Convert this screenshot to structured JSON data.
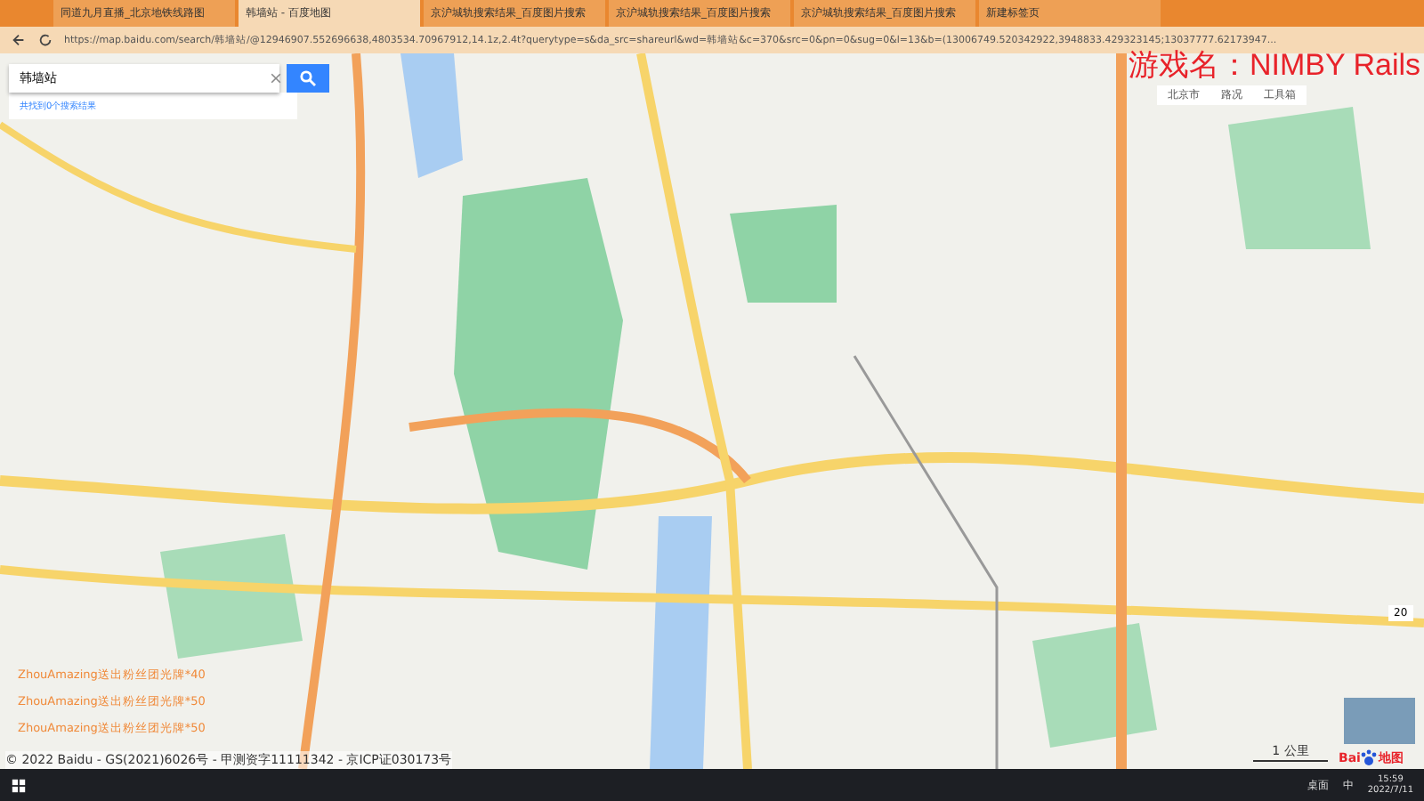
{
  "browser": {
    "tabs": [
      {
        "title": "同道九月直播_北京地铁线路图",
        "selected": false
      },
      {
        "title": "韩墙站 - 百度地图",
        "selected": true
      },
      {
        "title": "京沪城轨搜索结果_百度图片搜索",
        "selected": false
      },
      {
        "title": "京沪城轨搜索结果_百度图片搜索",
        "selected": false
      },
      {
        "title": "京沪城轨搜索结果_百度图片搜索",
        "selected": false
      },
      {
        "title": "新建标签页",
        "selected": false
      }
    ],
    "url": "https://map.baidu.com/search/韩墙站/@12946907.552696638,4803534.70967912,14.1z,2.4t?querytype=s&da_src=shareurl&wd=韩墙站&c=370&src=0&pn=0&sug=0&l=13&b=(13006749.520342922,3948833.429323145;13037777.62173947..."
  },
  "map": {
    "search": {
      "value": "韩墙站",
      "result_link": "共找到0个搜索结果"
    },
    "toolbar": [
      "北京市",
      "路况",
      "工具箱"
    ],
    "overlay_title": "游戏名：NIMBY Rails",
    "chat": [
      "ZhouAmazing送出粉丝团光牌*40",
      "ZhouAmazing送出粉丝团光牌*50",
      "ZhouAmazing送出粉丝团光牌*50"
    ],
    "footer": "© 2022 Baidu - GS(2021)6026号 - 甲测资字11111342 - 京ICP证030173号",
    "scale": "1 公里",
    "logo": {
      "left": "Bai",
      "right": "地图"
    },
    "zoom_level": "20"
  },
  "taskbar": {
    "desktop": "桌面",
    "ime": "中",
    "time": "15:59",
    "date": "2022/7/11"
  }
}
